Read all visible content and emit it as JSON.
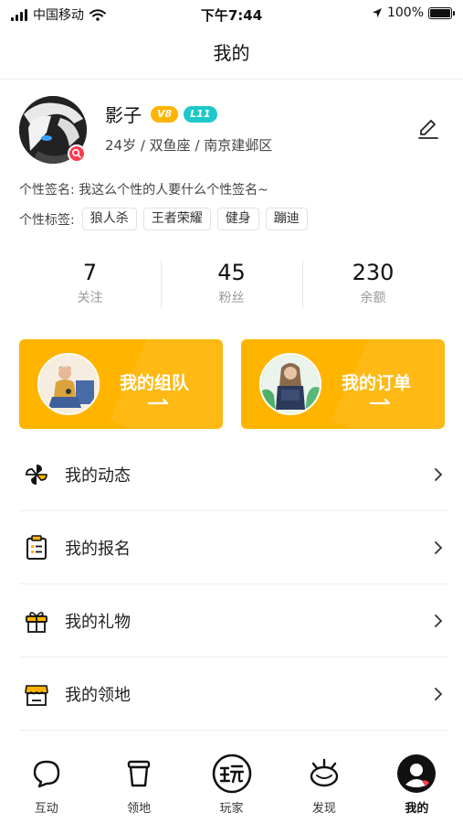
{
  "status_bar": {
    "carrier": "中国移动",
    "time": "下午7:44",
    "battery": "100%",
    "battery_level": 1.0,
    "icons": [
      "signal-icon",
      "wifi-icon",
      "location-arrow-icon",
      "battery-icon"
    ]
  },
  "nav": {
    "title": "我的"
  },
  "profile": {
    "name": "影子",
    "vip_badge": "V8",
    "level_badge": "L11",
    "meta": "24岁 / 双鱼座 / 南京建邺区",
    "signature_label": "个性签名:",
    "signature": "我这么个性的人要什么个性签名~",
    "tags_label": "个性标签:",
    "tags": [
      "狼人杀",
      "王者荣耀",
      "健身",
      "蹦迪"
    ],
    "edit_icon": "pencil-icon",
    "badge_color": "#ff3b4e"
  },
  "stats": [
    {
      "value": "7",
      "label": "关注"
    },
    {
      "value": "45",
      "label": "粉丝"
    },
    {
      "value": "230",
      "label": "余额"
    }
  ],
  "cards": {
    "team": {
      "label": "我的组队"
    },
    "order": {
      "label": "我的订单"
    }
  },
  "menu": [
    {
      "label": "我的动态",
      "icon": "pinwheel-icon"
    },
    {
      "label": "我的报名",
      "icon": "clipboard-icon"
    },
    {
      "label": "我的礼物",
      "icon": "gift-icon"
    },
    {
      "label": "我的领地",
      "icon": "store-icon"
    }
  ],
  "tabs": [
    {
      "label": "互动",
      "icon": "chat-bubble-icon"
    },
    {
      "label": "领地",
      "icon": "bucket-icon"
    },
    {
      "label": "玩家",
      "icon": "play-icon"
    },
    {
      "label": "发现",
      "icon": "eye-icon"
    },
    {
      "label": "我的",
      "icon": "profile-icon",
      "active": true
    }
  ],
  "colors": {
    "accent": "#ffb400",
    "level_badge": "#1ec8c8",
    "text": "#222222",
    "muted": "#999999"
  }
}
